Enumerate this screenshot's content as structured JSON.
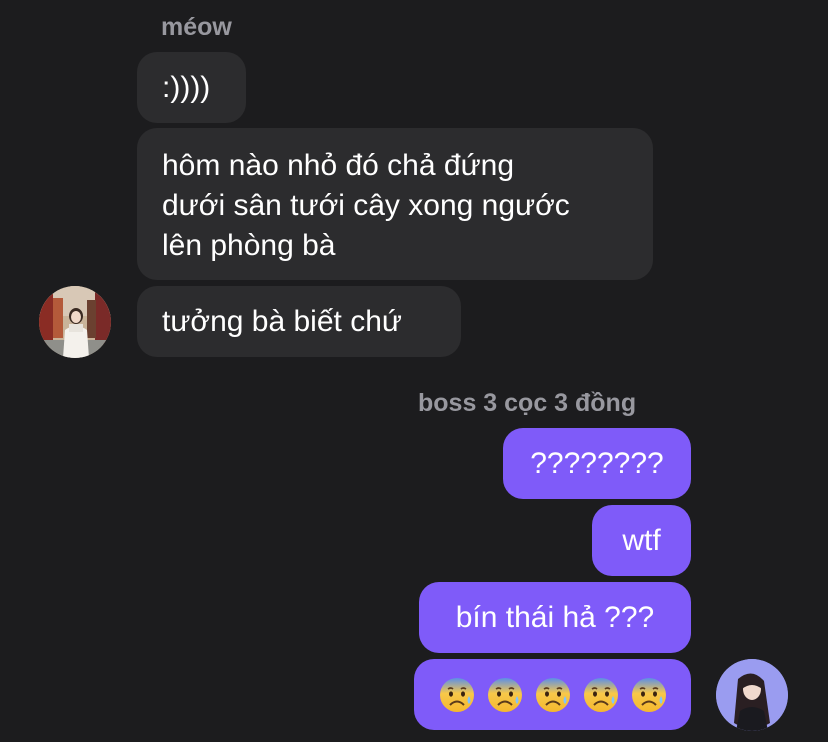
{
  "incoming": {
    "sender_name": "méow",
    "messages": [
      ":))))",
      "hôm nào nhỏ đó chả đứng\ndưới sân tưới cây xong ngước\nlên phòng bà",
      "tưởng bà biết chứ"
    ]
  },
  "outgoing": {
    "sender_name": "boss 3 cọc 3 đồng",
    "messages": [
      "????????",
      "wtf",
      "bín thái hả ???"
    ],
    "emoji_message": {
      "icon": "anxious-face-with-sweat-emoji",
      "count": 5
    }
  },
  "colors": {
    "background": "#1c1c1e",
    "incoming_bubble": "#2c2c2e",
    "outgoing_bubble": "#7f5bf9",
    "name_text": "#98989f"
  }
}
